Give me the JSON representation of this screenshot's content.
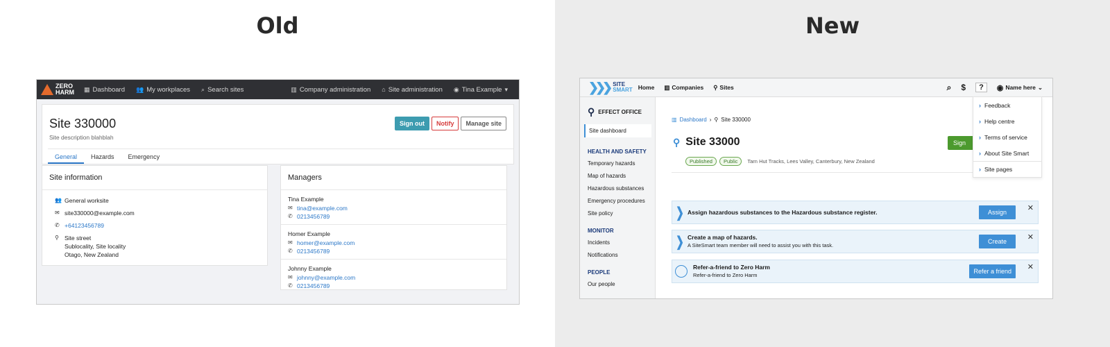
{
  "headings": {
    "old": "Old",
    "new": "New"
  },
  "old": {
    "nav": {
      "logo": [
        "ZERO",
        "HARM"
      ],
      "dashboard": "Dashboard",
      "workplaces": "My workplaces",
      "search": "Search sites",
      "company_admin": "Company administration",
      "site_admin": "Site administration",
      "user": "Tina Example"
    },
    "site_title": "Site 330000",
    "site_desc": "Site description blahblah",
    "buttons": {
      "signout": "Sign out",
      "notify": "Notify",
      "manage": "Manage site"
    },
    "tabs": [
      "General",
      "Hazards",
      "Emergency"
    ],
    "site_info": {
      "title": "Site information",
      "type": "General worksite",
      "email": "site330000@example.com",
      "phone": "+64123456789",
      "address": [
        "Site street",
        "Sublocality, Site locality",
        "Otago, New Zealand"
      ]
    },
    "managers": {
      "title": "Managers",
      "list": [
        {
          "name": "Tina Example",
          "email": "tina@example.com",
          "phone": "0213456789"
        },
        {
          "name": "Homer Example",
          "email": "homer@example.com",
          "phone": "0213456789"
        },
        {
          "name": "Johnny Example",
          "email": "johnny@example.com",
          "phone": "0213456789"
        }
      ]
    }
  },
  "new": {
    "nav": {
      "logo": [
        "SITE",
        "SMART"
      ],
      "home": "Home",
      "companies": "Companies",
      "sites": "Sites",
      "user": "Name here"
    },
    "sidebar": {
      "office": "EFFECT OFFICE",
      "dashboard": "Site dashboard",
      "health_title": "HEALTH AND SAFETY",
      "health_items": [
        "Temporary hazards",
        "Map of hazards",
        "Hazardous substances",
        "Emergency procedures",
        "Site policy"
      ],
      "monitor_title": "MONITOR",
      "monitor_items": [
        "Incidents",
        "Notifications"
      ],
      "people_title": "PEOPLE",
      "people_items": [
        "Our people"
      ]
    },
    "breadcrumb": {
      "dashboard": "Dashboard",
      "site": "Site 330000"
    },
    "title": "Site 33000",
    "badges": [
      "Published",
      "Public"
    ],
    "location": "Tarn Hut Tracks, Lees Valley, Canterbury, New Zealand",
    "sign_button": "Sign",
    "dropdown": [
      "Feedback",
      "Help centre",
      "Terms of service",
      "About Site Smart",
      "Site pages"
    ],
    "tasks": [
      {
        "title": "Assign hazardous substances to the Hazardous substance register.",
        "sub": "",
        "button": "Assign"
      },
      {
        "title": "Create a map of hazards.",
        "sub": "A SiteSmart team member will need to assist you with this task.",
        "button": "Create"
      },
      {
        "title": "Refer-a-friend to Zero Harm",
        "sub": "Refer-a-friend to Zero Harm",
        "button": "Refer a friend"
      }
    ]
  }
}
